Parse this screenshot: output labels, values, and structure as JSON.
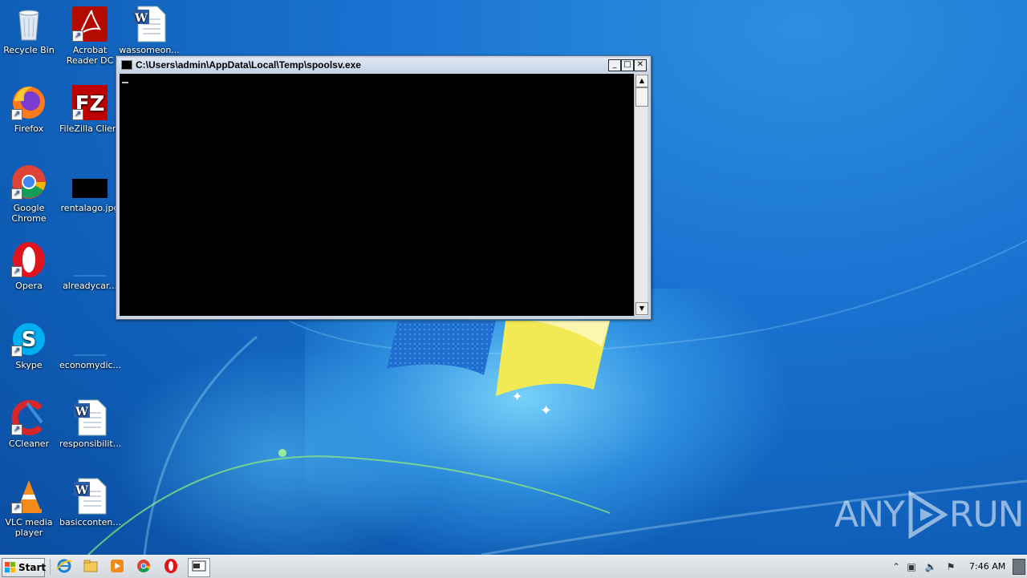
{
  "desktop": {
    "icons": [
      {
        "label": "Recycle Bin",
        "icon": "recycle-bin-icon"
      },
      {
        "label": "Acrobat Reader DC",
        "icon": "acrobat-icon"
      },
      {
        "label": "wassomeon...",
        "icon": "word-doc-icon"
      },
      {
        "label": "Firefox",
        "icon": "firefox-icon"
      },
      {
        "label": "FileZilla Client",
        "icon": "filezilla-icon"
      },
      {
        "label": "Google Chrome",
        "icon": "chrome-icon"
      },
      {
        "label": "rentalago.jpg",
        "icon": "image-file-icon"
      },
      {
        "label": "Opera",
        "icon": "opera-icon"
      },
      {
        "label": "alreadycar...",
        "icon": "blank-file-icon"
      },
      {
        "label": "Skype",
        "icon": "skype-icon"
      },
      {
        "label": "economydic...",
        "icon": "blank-file-icon"
      },
      {
        "label": "CCleaner",
        "icon": "ccleaner-icon"
      },
      {
        "label": "responsibilit...",
        "icon": "word-doc-icon"
      },
      {
        "label": "VLC media player",
        "icon": "vlc-icon"
      },
      {
        "label": "basicconten...",
        "icon": "word-doc-icon"
      }
    ]
  },
  "console": {
    "title": "C:\\Users\\admin\\AppData\\Local\\Temp\\spoolsv.exe",
    "minimize": "_",
    "maximize": "□",
    "close": "✕",
    "scroll_up": "▲",
    "scroll_down": "▼"
  },
  "watermark": {
    "left": "ANY",
    "right": "RUN"
  },
  "taskbar": {
    "start_label": "Start",
    "pinned": [
      "internet-explorer-icon",
      "file-explorer-icon",
      "media-player-icon",
      "chrome-icon",
      "opera-icon",
      "console-window-icon"
    ],
    "clock": "7:46 AM"
  },
  "colors": {
    "desktop": "#1a74d2",
    "taskbar": "#dde1e5",
    "console_bg": "#000000"
  }
}
